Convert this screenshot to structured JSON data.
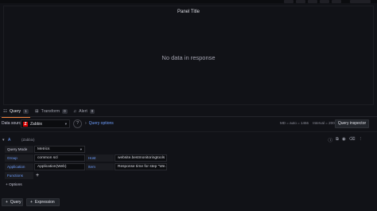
{
  "panel": {
    "title": "Panel Title",
    "empty_message": "No data in response"
  },
  "tabs": [
    {
      "label": "Query",
      "count": "1",
      "icon": "database-icon",
      "active": true
    },
    {
      "label": "Transform",
      "count": "0",
      "icon": "transform-icon",
      "active": false
    },
    {
      "label": "Alert",
      "count": "0",
      "icon": "bell-icon",
      "active": false
    }
  ],
  "datasource": {
    "label": "Data source",
    "selected": "Zabbix",
    "logo_text": "Z",
    "query_options_label": "Query options",
    "summary": {
      "max_data_points": "MD = auto = 1466",
      "interval": "Interval = 200ms"
    },
    "query_inspector_label": "Query inspector"
  },
  "query": {
    "ref_id": "A",
    "ds_name": "(Zabbix)",
    "query_mode_label": "Query Mode",
    "query_mode_value": "Metrics",
    "group_label": "Group",
    "group_value": "common scl",
    "host_label": "Host",
    "host_value": "website.bestmonitoringtools",
    "application_label": "Application",
    "application_value": "Application(Web)",
    "item_label": "Item",
    "item_value": "Response time for step \"We...",
    "functions_label": "Functions",
    "functions_add": "+",
    "options_label": "+ Options"
  },
  "buttons": {
    "add_query": "Query",
    "add_expression": "Expression"
  },
  "colors": {
    "background": "#111217",
    "accent": "#f2823a",
    "link": "#6e9fff",
    "zabbix_red": "#d40000"
  }
}
